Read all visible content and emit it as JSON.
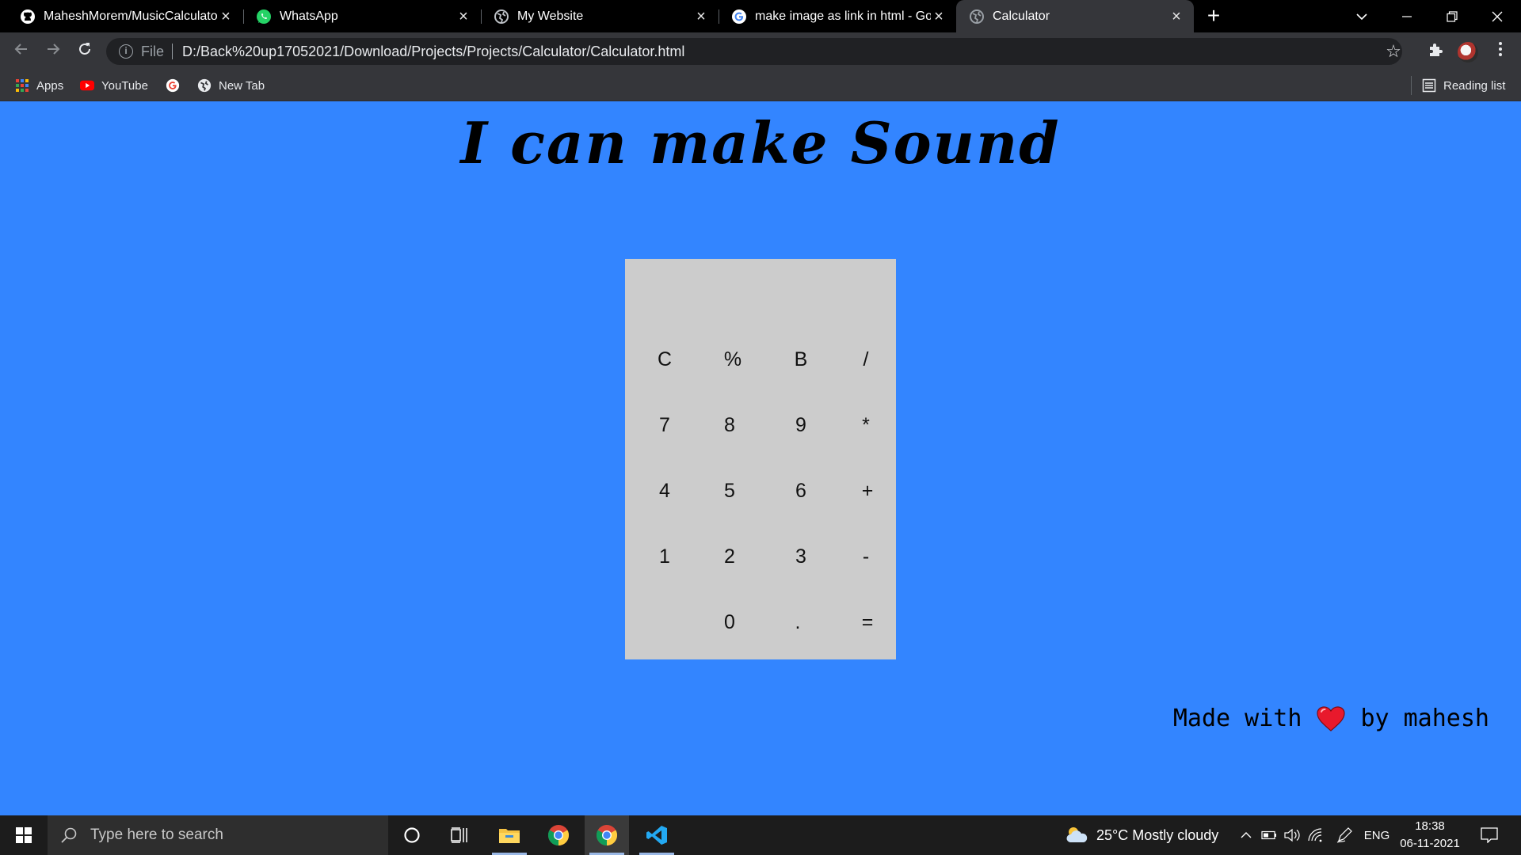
{
  "browser": {
    "tabs": [
      {
        "title": "MaheshMorem/MusicCalculator:",
        "icon": "github-icon",
        "active": false
      },
      {
        "title": "WhatsApp",
        "icon": "whatsapp-icon",
        "active": false
      },
      {
        "title": "My Website",
        "icon": "globe-icon",
        "active": false
      },
      {
        "title": "make image as link in html - Goo",
        "icon": "google-icon",
        "active": false
      },
      {
        "title": "Calculator",
        "icon": "globe-icon",
        "active": true
      }
    ],
    "address": {
      "scheme": "File",
      "url": "D:/Back%20up17052021/Download/Projects/Projects/Calculator/Calculator.html"
    },
    "bookmarks": [
      {
        "label": "Apps",
        "icon": "apps-grid-icon"
      },
      {
        "label": "YouTube",
        "icon": "youtube-icon"
      },
      {
        "label": "",
        "icon": "google-icon"
      },
      {
        "label": "New Tab",
        "icon": "globe-icon"
      }
    ],
    "reading_list": "Reading list"
  },
  "page": {
    "heading": "I can make Sound",
    "calculator": {
      "display": "",
      "keys": [
        [
          "C",
          "%",
          "B",
          "/"
        ],
        [
          "7",
          "8",
          "9",
          "*"
        ],
        [
          "4",
          "5",
          "6",
          "+"
        ],
        [
          "1",
          "2",
          "3",
          "-"
        ],
        [
          "",
          "0",
          ".",
          "="
        ]
      ]
    },
    "credit": {
      "before": "Made with",
      "after": "by mahesh",
      "heart_color": "#e8192c"
    }
  },
  "taskbar": {
    "search_placeholder": "Type here to search",
    "weather": "25°C  Mostly cloudy",
    "language": "ENG",
    "time": "18:38",
    "date": "06-11-2021"
  },
  "colors": {
    "page_background": "#3385ff",
    "calculator_background": "#cccccc"
  }
}
